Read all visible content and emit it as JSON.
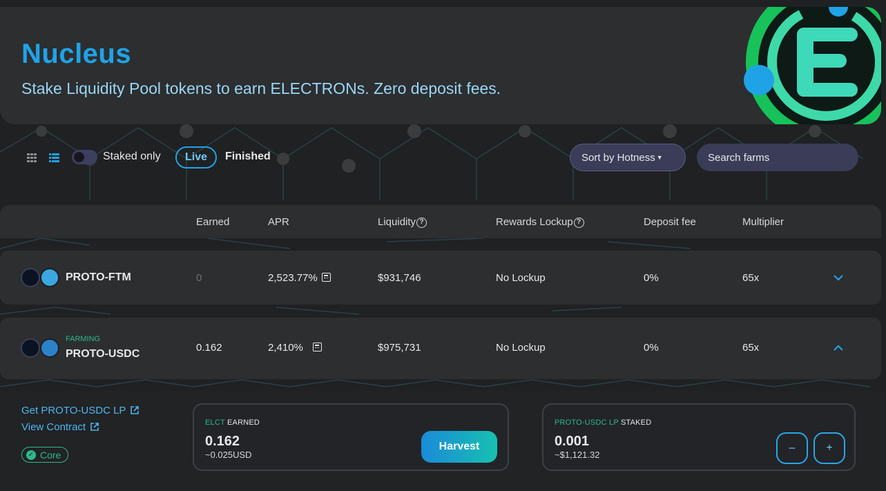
{
  "header": {
    "title": "Nucleus",
    "subtitle": "Stake Liquidity Pool tokens to earn ELECTRONs. Zero deposit fees."
  },
  "controls": {
    "view_grid_icon": "grid-view-icon",
    "view_list_icon": "list-view-icon",
    "staked_only_label": "Staked only",
    "staked_only_on": false,
    "tab_live": "Live",
    "tab_finished": "Finished",
    "active_tab": "Live",
    "sort_label": "Sort by Hotness",
    "search_placeholder": "Search farms"
  },
  "table": {
    "columns": {
      "earned": "Earned",
      "apr": "APR",
      "liquidity": "Liquidity",
      "rewards_lockup": "Rewards Lockup",
      "deposit_fee": "Deposit fee",
      "multiplier": "Multiplier"
    },
    "rows": [
      {
        "name": "PROTO-FTM",
        "badge": "",
        "earned": "0",
        "apr": "2,523.77%",
        "liquidity": "$931,746",
        "lockup": "No Lockup",
        "deposit_fee": "0%",
        "multiplier": "65x",
        "expanded": false
      },
      {
        "name": "PROTO-USDC",
        "badge": "FARMING",
        "earned": "0.162",
        "apr": "2,410%",
        "liquidity": "$975,731",
        "lockup": "No Lockup",
        "deposit_fee": "0%",
        "multiplier": "65x",
        "expanded": true
      }
    ]
  },
  "details": {
    "get_lp_link": "Get PROTO-USDC LP",
    "view_contract_link": "View Contract",
    "core_badge": "Core",
    "earned_card": {
      "token": "ELCT",
      "label": "EARNED",
      "amount": "0.162",
      "usd": "~0.025USD",
      "harvest_label": "Harvest"
    },
    "staked_card": {
      "token": "PROTO-USDC LP",
      "label": "STAKED",
      "amount": "0.001",
      "usd": "~$1,121.32",
      "minus_label": "–",
      "plus_label": "+"
    }
  },
  "colors": {
    "background": "#1f2123",
    "panel": "#2c2e30",
    "accent_blue": "#1fa3e6",
    "accent_green": "#2fb889",
    "highlight_red": "#e0242a"
  }
}
